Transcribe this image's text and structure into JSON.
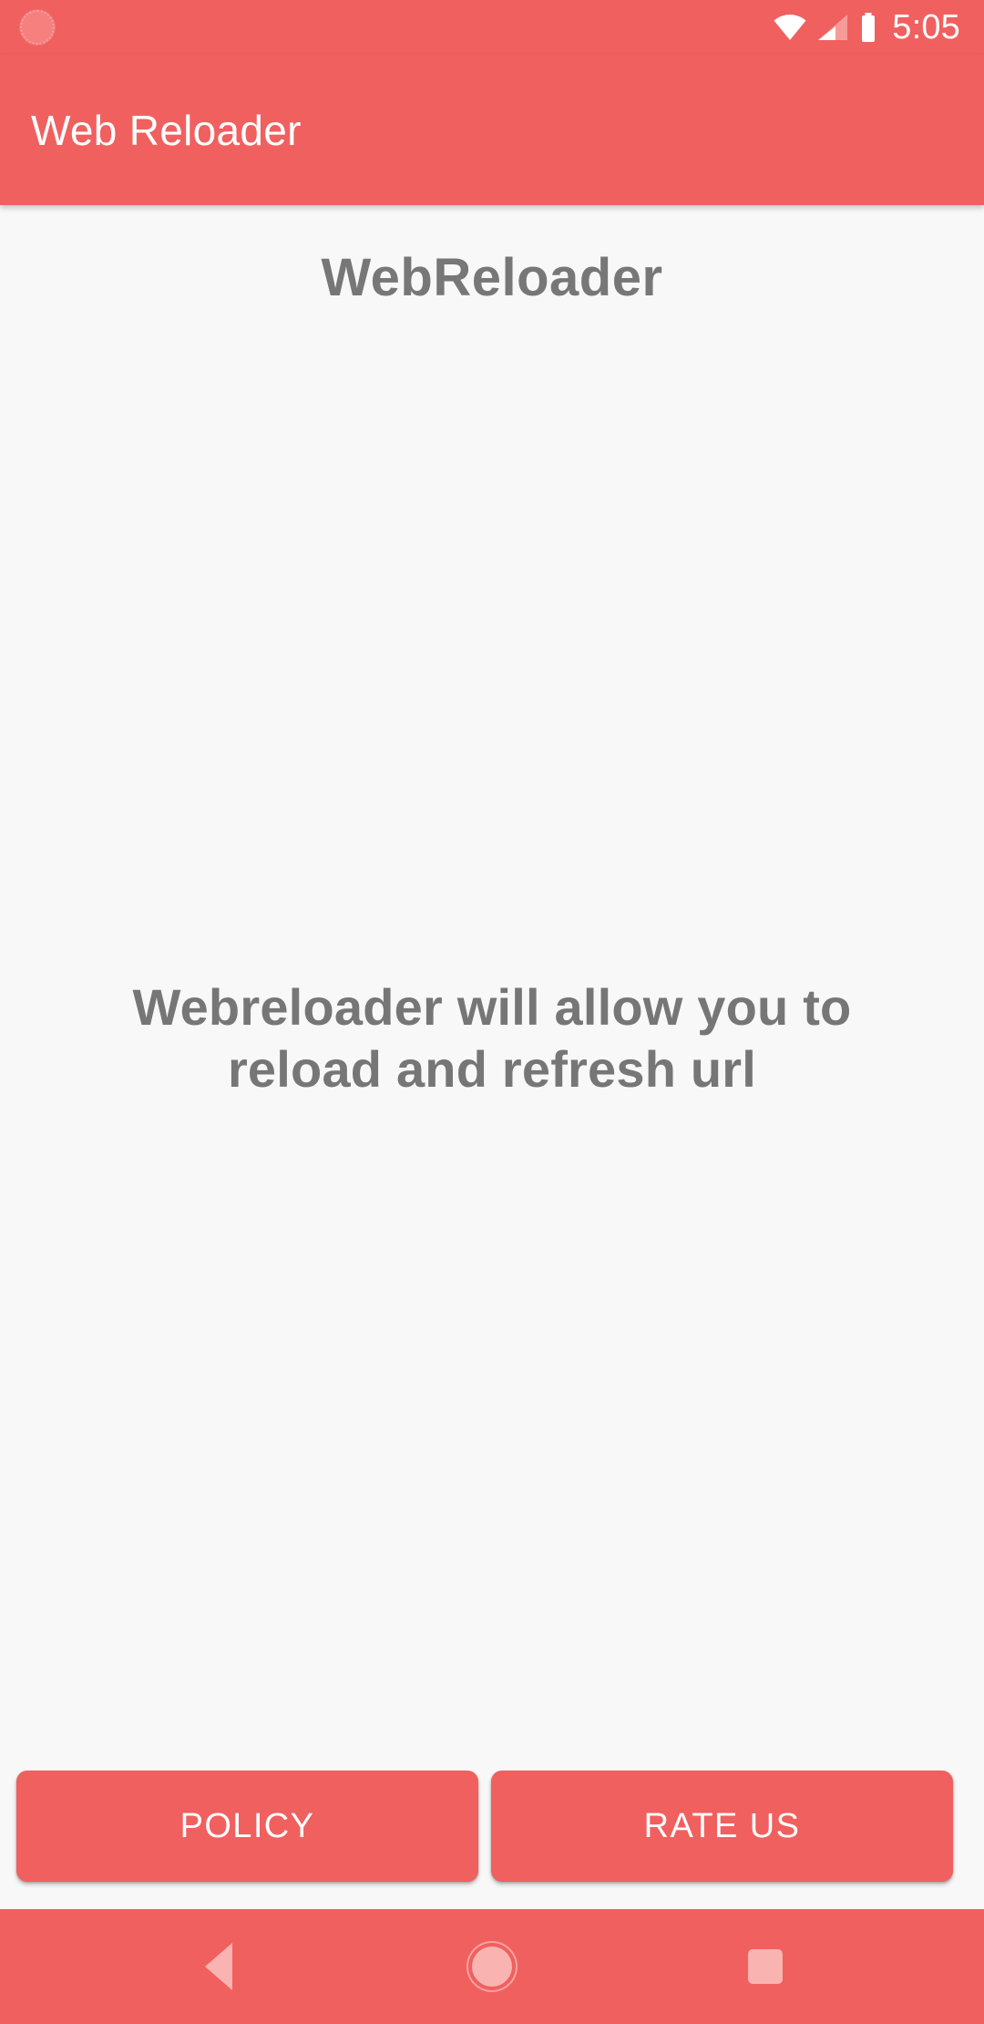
{
  "status_bar": {
    "time": "5:05",
    "notification_icon": "app-notification-icon",
    "wifi_icon": "wifi-icon",
    "cell_icon": "cellular-signal-icon",
    "battery_icon": "battery-icon"
  },
  "app_bar": {
    "title": "Web Reloader"
  },
  "content": {
    "heading": "WebReloader",
    "body_text": "Webreloader will allow you to reload and refresh url"
  },
  "buttons": {
    "policy_label": "POLICY",
    "rate_us_label": "RATE US"
  },
  "nav_bar": {
    "back_label": "Back",
    "home_label": "Home",
    "recents_label": "Recents"
  },
  "colors": {
    "accent": "#f0605f",
    "background": "#f8f8f8",
    "text_gray": "#767676",
    "on_accent": "#ffffff",
    "nav_icon": "#f9b3b1"
  }
}
